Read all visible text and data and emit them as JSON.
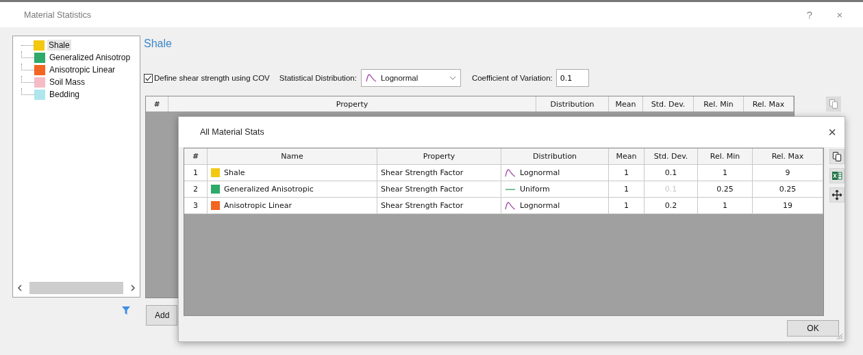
{
  "window": {
    "title": "Material Statistics",
    "help_button": "?",
    "close_button": "×"
  },
  "materials_tree": {
    "items": [
      {
        "label": "Shale",
        "color": "#f2c811",
        "selected": true
      },
      {
        "label": "Generalized Anisotrop",
        "color": "#2eaa6a",
        "selected": false
      },
      {
        "label": "Anisotropic Linear",
        "color": "#f26522",
        "selected": false
      },
      {
        "label": "Soil Mass",
        "color": "#f6bcc6",
        "selected": false
      },
      {
        "label": "Bedding",
        "color": "#aee6ee",
        "selected": false
      }
    ]
  },
  "selected_material": {
    "title": "Shale",
    "define_cov": {
      "label": "Define shear strength using COV",
      "checked": true
    },
    "distribution": {
      "label": "Statistical Distribution:",
      "value": "Lognormal",
      "kind": "lognormal"
    },
    "cov": {
      "label": "Coefficient of Variation:",
      "value": "0.1"
    }
  },
  "property_table": {
    "columns": [
      "#",
      "Property",
      "Distribution",
      "Mean",
      "Std. Dev.",
      "Rel. Min",
      "Rel. Max"
    ]
  },
  "add_button": "Add",
  "stats_dialog": {
    "title": "All Material Stats",
    "close_button": "×",
    "columns": [
      "#",
      "Name",
      "Property",
      "Distribution",
      "Mean",
      "Std. Dev.",
      "Rel. Min",
      "Rel. Max"
    ],
    "rows": [
      {
        "index": "1",
        "name": "Shale",
        "color": "#f2c811",
        "property": "Shear Strength Factor",
        "distribution": {
          "kind": "lognormal",
          "label": "Lognormal"
        },
        "mean": "1",
        "std_dev": "0.1",
        "std_dev_disabled": false,
        "rel_min": "1",
        "rel_max": "9"
      },
      {
        "index": "2",
        "name": "Generalized Anisotropic",
        "color": "#2eaa6a",
        "property": "Shear Strength Factor",
        "distribution": {
          "kind": "uniform",
          "label": "Uniform"
        },
        "mean": "1",
        "std_dev": "0.1",
        "std_dev_disabled": true,
        "rel_min": "0.25",
        "rel_max": "0.25"
      },
      {
        "index": "3",
        "name": "Anisotropic Linear",
        "color": "#f26522",
        "property": "Shear Strength Factor",
        "distribution": {
          "kind": "lognormal",
          "label": "Lognormal"
        },
        "mean": "1",
        "std_dev": "0.2",
        "std_dev_disabled": false,
        "rel_min": "1",
        "rel_max": "19"
      }
    ],
    "ok_button": "OK"
  }
}
